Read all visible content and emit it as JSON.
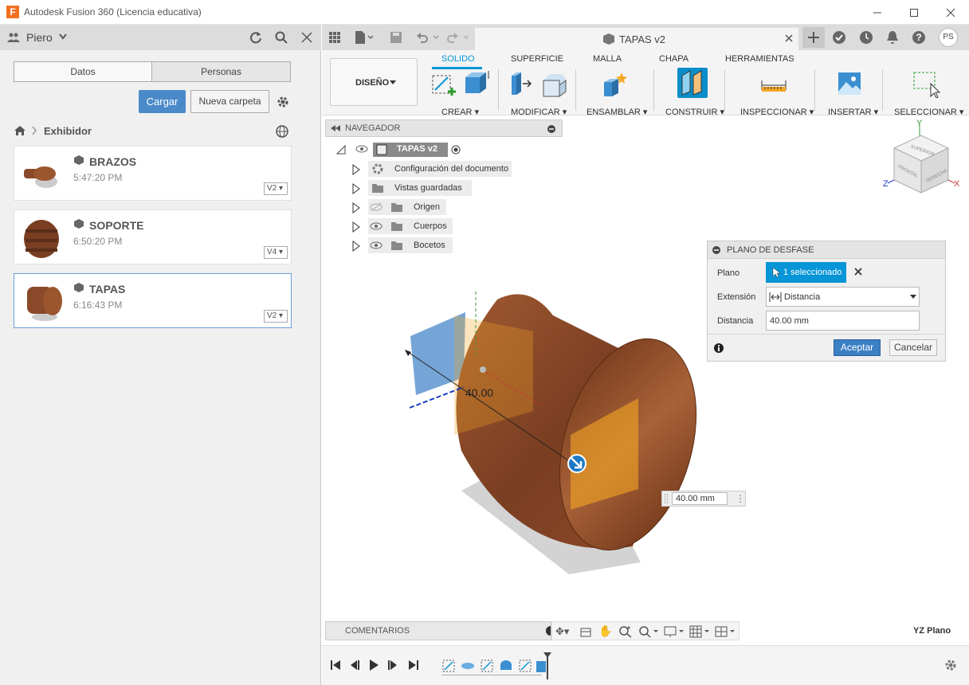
{
  "window": {
    "title": "Autodesk Fusion 360 (Licencia educativa)"
  },
  "left": {
    "user": "Piero",
    "tabs": [
      "Datos",
      "Personas"
    ],
    "upload_label": "Cargar",
    "new_folder_label": "Nueva carpeta",
    "breadcrumb": "Exhibidor",
    "files": [
      {
        "name": "BRAZOS",
        "time": "5:47:20 PM",
        "version": "V2"
      },
      {
        "name": "SOPORTE",
        "time": "6:50:20 PM",
        "version": "V4"
      },
      {
        "name": "TAPAS",
        "time": "6:16:43 PM",
        "version": "V2"
      }
    ]
  },
  "document": {
    "tab_title": "TAPAS v2",
    "user_initials": "PS"
  },
  "ribbon": {
    "workspace": "DISEÑO",
    "tabs": [
      "SOLIDO",
      "SUPERFICIE",
      "MALLA",
      "CHAPA",
      "HERRAMIENTAS"
    ],
    "groups": [
      "CREAR",
      "MODIFICAR",
      "ENSAMBLAR",
      "CONSTRUIR",
      "INSPECCIONAR",
      "INSERTAR",
      "SELECCIONAR"
    ]
  },
  "navigator": {
    "title": "NAVEGADOR",
    "root": "TAPAS v2",
    "items": [
      "Configuración del documento",
      "Vistas guardadas",
      "Origen",
      "Cuerpos",
      "Bocetos"
    ]
  },
  "dialog": {
    "title": "PLANO DE DESFASE",
    "plane_label": "Plano",
    "plane_value": "1 seleccionado",
    "extent_label": "Extensión",
    "extent_value": "Distancia",
    "distance_label": "Distancia",
    "distance_value": "40.00 mm",
    "ok": "Aceptar",
    "cancel": "Cancelar"
  },
  "viewport": {
    "dimension_text": "40.00",
    "input_value": "40.00 mm",
    "comments": "COMENTARIOS",
    "status": "YZ Plano",
    "cube": {
      "top": "SUPERIOR",
      "front": "FRONTAL",
      "right": "DERECHA"
    },
    "axes": {
      "x": "X",
      "y": "Y",
      "z": "Z"
    }
  },
  "colors": {
    "accent": "#0696d7",
    "button_blue": "#4a8ac9",
    "wood": "#8a4a2a",
    "plane": "#f5a623"
  }
}
